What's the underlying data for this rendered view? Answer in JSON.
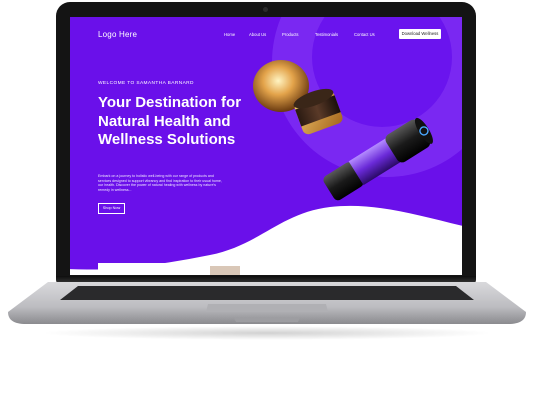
{
  "nav": {
    "logo": "Logo Here",
    "links": [
      "Home",
      "About Us",
      "Products",
      "Testimonials",
      "Contact Us"
    ],
    "cta": "Download Wellness"
  },
  "hero": {
    "eyebrow": "WELCOME TO SAMANTHA BARNARD",
    "headline": "Your Destination for Natural Health and Wellness Solutions",
    "body": "Embark on a journey to holistic well-being with our range of products and services designed to support vibrancy and find inspiration to their usual home, our health. Discover the power of natural healing with wellness by nature's remedy in wellness...",
    "button": "Shop Now"
  },
  "colors": {
    "primary": "#6a10ea",
    "accent": "#ffffff",
    "glow": "#7a28f2"
  }
}
